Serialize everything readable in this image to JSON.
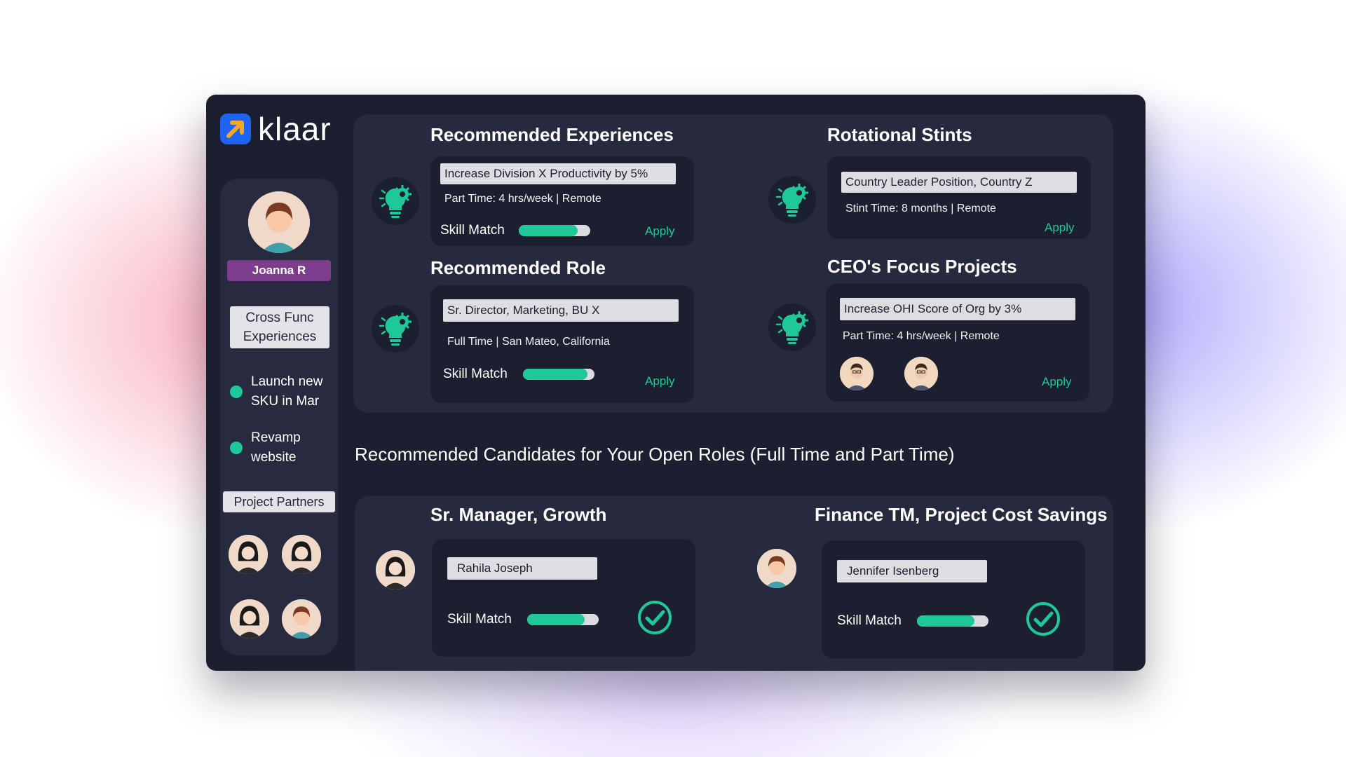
{
  "app": {
    "logo_text": "klaar"
  },
  "colors": {
    "accent": "#1ec997",
    "background": "#1c1f30",
    "panel": "#272a3f",
    "sidebar": "#282b40",
    "name_badge": "#7d3d8c",
    "logo_blue": "#1e63f2",
    "logo_arrow": "#f5a623"
  },
  "sidebar": {
    "user_name": "Joanna R",
    "section_label": "Cross Func Experiences",
    "projects": [
      {
        "label": "Launch new SKU in Mar"
      },
      {
        "label": "Revamp website"
      }
    ],
    "partners_label": "Project Partners"
  },
  "recommended_experiences": {
    "title": "Recommended Experiences",
    "item_title": "Increase Division X Productivity by 5%",
    "meta": "Part Time: 4 hrs/week | Remote",
    "skill_label": "Skill Match",
    "skill_match": 0.82,
    "apply_label": "Apply",
    "icon": "lightbulb-gear-icon"
  },
  "rotational_stints": {
    "title": "Rotational Stints",
    "item_title": "Country Leader Position, Country Z",
    "meta": "Stint Time: 8 months | Remote",
    "apply_label": "Apply",
    "icon": "lightbulb-gear-icon"
  },
  "recommended_role": {
    "title": "Recommended Role",
    "item_title": "Sr. Director, Marketing, BU X",
    "meta": "Full Time | San Mateo, California",
    "skill_label": "Skill Match",
    "skill_match": 0.9,
    "apply_label": "Apply",
    "icon": "lightbulb-gear-icon"
  },
  "ceo_focus": {
    "title": "CEO's Focus Projects",
    "item_title": "Increase OHI Score of Org by 3%",
    "meta": "Part Time: 4 hrs/week | Remote",
    "apply_label": "Apply",
    "icon": "lightbulb-gear-icon"
  },
  "candidates": {
    "heading": "Recommended Candidates for Your Open Roles (Full Time and Part Time)",
    "roles": [
      {
        "title": "Sr. Manager, Growth",
        "candidate": "Rahila Joseph",
        "skill_label": "Skill Match",
        "skill_match": 0.8,
        "icon": "check-circle-icon"
      },
      {
        "title": "Finance TM, Project Cost Savings",
        "candidate": "Jennifer Isenberg",
        "skill_label": "Skill Match",
        "skill_match": 0.8,
        "icon": "check-circle-icon"
      }
    ]
  }
}
